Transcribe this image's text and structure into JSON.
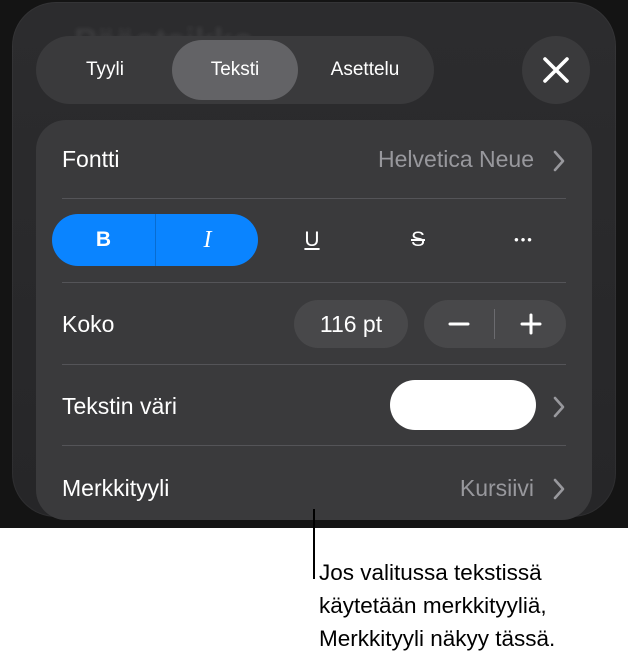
{
  "panel": {
    "ghost_title": "Pääotsikko"
  },
  "tabs": [
    {
      "label": "Tyyli",
      "active": false
    },
    {
      "label": "Teksti",
      "active": true
    },
    {
      "label": "Asettelu",
      "active": false
    }
  ],
  "close_icon": "close-icon",
  "font_row": {
    "label": "Fontti",
    "value": "Helvetica Neue"
  },
  "style_buttons": {
    "bold": "B",
    "italic": "I",
    "underline": "U",
    "strikethrough": "S",
    "more": "•••"
  },
  "size_row": {
    "label": "Koko",
    "value": "116 pt"
  },
  "color_row": {
    "label": "Tekstin väri",
    "swatch_color": "#ffffff"
  },
  "char_style_row": {
    "label": "Merkkityyli",
    "value": "Kursiivi"
  },
  "callout": {
    "line1": "Jos valitussa tekstissä",
    "line2": "käytetään merkkityyliä,",
    "line3": "Merkkityyli näkyy tässä."
  },
  "colors": {
    "accent": "#0a84ff",
    "panel": "#2c2c2e",
    "card": "#3a3a3c",
    "secondary_text": "#98989d"
  }
}
